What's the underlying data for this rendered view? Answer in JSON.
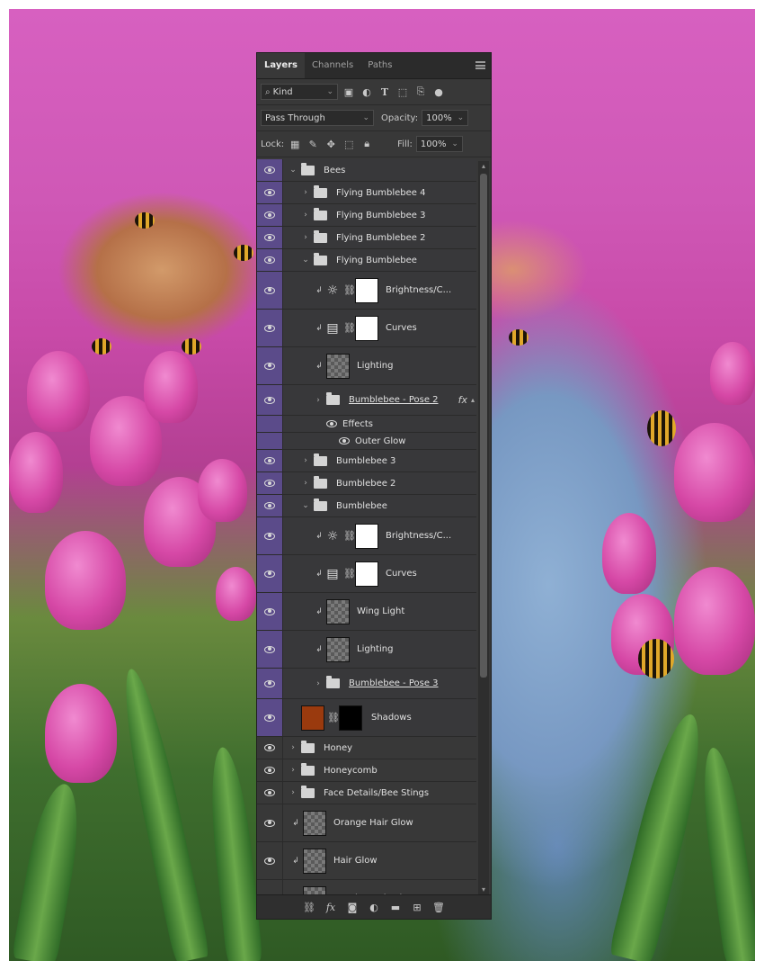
{
  "panel": {
    "tabs": [
      "Layers",
      "Channels",
      "Paths"
    ],
    "menu_icon": "hamburger-menu-icon",
    "filter": {
      "label": "Kind",
      "icons": [
        "image-filter-icon",
        "adjustment-filter-icon",
        "type-filter-icon",
        "shape-filter-icon",
        "smart-object-filter-icon",
        "filter-toggle-icon"
      ]
    },
    "blend_mode": "Pass Through",
    "opacity_label": "Opacity:",
    "opacity_value": "100%",
    "lock_label": "Lock:",
    "lock_icons": [
      "lock-transparent-icon",
      "lock-image-icon",
      "lock-position-icon",
      "lock-artboard-icon",
      "lock-all-icon"
    ],
    "fill_label": "Fill:",
    "fill_value": "100%",
    "layers": [
      {
        "name": "Bees",
        "type": "group",
        "indent": 0,
        "expanded": true,
        "selected": true
      },
      {
        "name": "Flying Bumblebee 4",
        "type": "group",
        "indent": 1,
        "expanded": false,
        "selected": true
      },
      {
        "name": "Flying Bumblebee 3",
        "type": "group",
        "indent": 1,
        "expanded": false,
        "selected": true
      },
      {
        "name": "Flying Bumblebee 2",
        "type": "group",
        "indent": 1,
        "expanded": false,
        "selected": true
      },
      {
        "name": "Flying Bumblebee",
        "type": "group",
        "indent": 1,
        "expanded": true,
        "selected": true
      },
      {
        "name": "Brightness/C...",
        "type": "adjustment",
        "icon": "brightness-icon",
        "indent": 2,
        "selected": true
      },
      {
        "name": "Curves",
        "type": "adjustment",
        "icon": "curves-icon",
        "indent": 2,
        "selected": true
      },
      {
        "name": "Lighting",
        "type": "pixel",
        "indent": 2,
        "selected": true
      },
      {
        "name": "Bumblebee - Pose 2",
        "type": "smartgroup",
        "indent": 2,
        "expanded": false,
        "selected": true,
        "fx": "fx"
      },
      {
        "name": "Effects",
        "type": "effects",
        "indent": 3,
        "selected": true
      },
      {
        "name": "Outer Glow",
        "type": "effect",
        "indent": 4,
        "selected": true
      },
      {
        "name": "Bumblebee 3",
        "type": "group",
        "indent": 1,
        "expanded": false,
        "selected": true
      },
      {
        "name": "Bumblebee 2",
        "type": "group",
        "indent": 1,
        "expanded": false,
        "selected": true
      },
      {
        "name": "Bumblebee",
        "type": "group",
        "indent": 1,
        "expanded": true,
        "selected": true
      },
      {
        "name": "Brightness/C...",
        "type": "adjustment",
        "icon": "brightness-icon",
        "indent": 2,
        "selected": true
      },
      {
        "name": "Curves",
        "type": "adjustment",
        "icon": "curves-icon",
        "indent": 2,
        "selected": true
      },
      {
        "name": "Wing Light",
        "type": "pixel",
        "indent": 2,
        "selected": true
      },
      {
        "name": "Lighting",
        "type": "pixel",
        "indent": 2,
        "selected": true
      },
      {
        "name": "Bumblebee - Pose 3",
        "type": "smartgroup",
        "indent": 2,
        "expanded": false,
        "selected": true
      },
      {
        "name": "Shadows",
        "type": "masked",
        "indent": 1,
        "selected": true
      },
      {
        "name": "Honey",
        "type": "group",
        "indent": 0,
        "expanded": false,
        "selected": false
      },
      {
        "name": "Honeycomb",
        "type": "group",
        "indent": 0,
        "expanded": false,
        "selected": false
      },
      {
        "name": "Face Details/Bee Stings",
        "type": "group",
        "indent": 0,
        "expanded": false,
        "selected": false
      },
      {
        "name": "Orange Hair Glow",
        "type": "pixel",
        "indent": 0,
        "selected": false
      },
      {
        "name": "Hair Glow",
        "type": "pixel",
        "indent": 0,
        "selected": false
      },
      {
        "name": "Overlay Hair Glow",
        "type": "pixel",
        "indent": 0,
        "selected": false
      }
    ],
    "footer_icons": [
      "link-layers-icon",
      "fx-icon",
      "add-mask-icon",
      "adjustment-layer-icon",
      "new-group-icon",
      "new-layer-icon",
      "trash-icon"
    ],
    "accent_color": "#5b4b8a"
  }
}
